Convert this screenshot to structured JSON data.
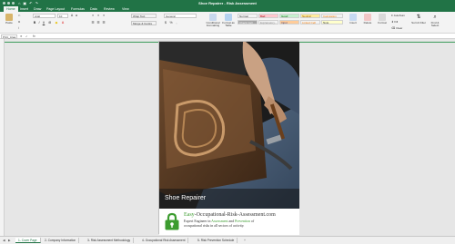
{
  "window": {
    "title": "Shoe Repairer - Risk Assessment"
  },
  "ribbon_tabs": [
    "Home",
    "Insert",
    "Draw",
    "Page Layout",
    "Formulas",
    "Data",
    "Review",
    "View"
  ],
  "ribbon": {
    "paste_label": "Paste",
    "font_name": "Arial",
    "font_size": "10",
    "wrap_text": "Wrap Text",
    "merge_center": "Merge & Centre",
    "number_format": "General",
    "conditional_formatting": "Conditional Formatting",
    "format_as_table": "Format as Table",
    "styles": [
      {
        "label": "Normal",
        "bg": "#ffffff",
        "color": "#333333"
      },
      {
        "label": "Bad",
        "bg": "#ffc7ce",
        "color": "#9c0006"
      },
      {
        "label": "Good",
        "bg": "#c6efce",
        "color": "#006100"
      },
      {
        "label": "Neutral",
        "bg": "#ffeb9c",
        "color": "#9c5700"
      },
      {
        "label": "Calculation",
        "bg": "#f2f2f2",
        "color": "#fa7d00"
      },
      {
        "label": "Check Cell",
        "bg": "#a5a5a5",
        "color": "#ffffff"
      },
      {
        "label": "Explanatory...",
        "bg": "#ffffff",
        "color": "#7f7f7f"
      },
      {
        "label": "Input",
        "bg": "#ffcc99",
        "color": "#3f3f76"
      },
      {
        "label": "Linked Cell",
        "bg": "#ffffff",
        "color": "#fa7d00"
      },
      {
        "label": "Note",
        "bg": "#ffffcc",
        "color": "#333333"
      }
    ],
    "insert": "Insert",
    "delete": "Delete",
    "format": "Format",
    "autosum": "AutoSum",
    "fill": "Fill",
    "clear": "Clear",
    "sort_filter": "Sort & Filter",
    "find_select": "Find & Select"
  },
  "formula_bar": {
    "name_box": "Print_Area",
    "fx": "fx",
    "value": ""
  },
  "page": {
    "caption": "Shoe Repairer",
    "site_prefix": "Easy",
    "site_rest": "-Occupational-Risk-Assessment.com",
    "tagline_1": "Expert Engineer in ",
    "tagline_hl1": "Assessment",
    "tagline_2": " and ",
    "tagline_hl2": "Prevention",
    "tagline_3": " of",
    "tagline_line2": "occupational risks in all sectors of activity."
  },
  "sheet_tabs": [
    "1- Cover Page",
    "2- Company Information",
    "3- Risk Assessment Methodology",
    "4- Occupational Risk Assessment",
    "5- Risk Prevention Schedule"
  ],
  "colors": {
    "excel_green": "#217346",
    "brand_green": "#3c9c2f"
  }
}
